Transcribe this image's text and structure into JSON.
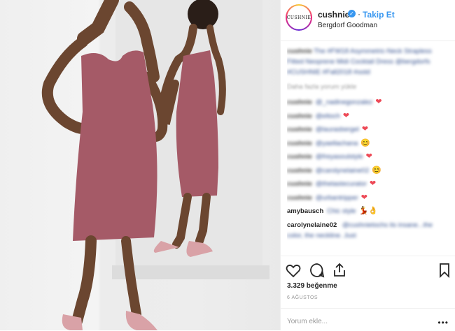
{
  "post": {
    "username": "cushnie",
    "avatar_text": "CUSHNIE",
    "follow_label": "Takip Et",
    "location": "Bergdorf Goodman",
    "caption_user": "cushnie",
    "caption_text": "The #FW18 Asymmetric-Neck Strapless Fitted Neoprene Midi Cocktail Dress @bergdorfs #CUSHNIE #Fall2018 #ootd",
    "load_more": "Daha fazla yorum yükle",
    "comments": [
      {
        "user": "cushnie",
        "text": "@_nadinegonzalez",
        "emoji": "❤"
      },
      {
        "user": "cushnie",
        "text": "@eltoch",
        "emoji": "❤"
      },
      {
        "user": "cushnie",
        "text": "@laurasbergel",
        "emoji": "❤"
      },
      {
        "user": "cushnie",
        "text": "@yaellachana",
        "emoji": "😊"
      },
      {
        "user": "cushnie",
        "text": "@freyasoulstyle",
        "emoji": "❤"
      },
      {
        "user": "cushnie",
        "text": "@carolynelaine02",
        "emoji": "😊"
      },
      {
        "user": "cushnie",
        "text": "@thetastecurator",
        "emoji": "❤"
      },
      {
        "user": "cushnie",
        "text": "@urbantripper",
        "emoji": "❤"
      }
    ],
    "comment_amy_user": "amybausch",
    "comment_amy_text": "Chic style",
    "comment_amy_emoji": "💃👌",
    "comment_carolyn_user": "carolynelaine02",
    "comment_carolyn_text": "@cushnietochs its insane...the color, the neckline. Just",
    "likes": "3.329 beğenme",
    "date": "6 AĞUSTOS",
    "comment_placeholder": "Yorum ekle...",
    "menu_dots": "•••"
  },
  "icons": [
    "heart-icon",
    "comment-icon",
    "share-icon",
    "bookmark-icon"
  ],
  "colors": {
    "link": "#3897f0",
    "dress": "#a55a67",
    "heart": "#ed4956"
  }
}
